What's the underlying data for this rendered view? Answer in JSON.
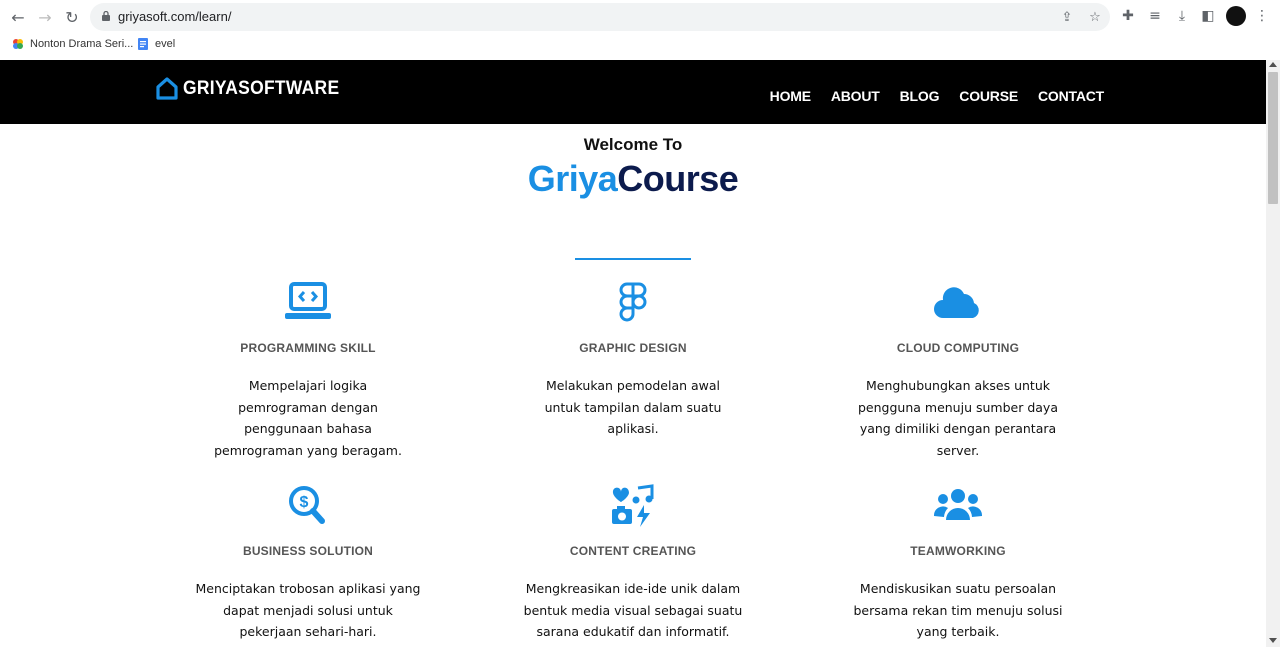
{
  "browser": {
    "url": "griyasoft.com/learn/",
    "bookmarks": [
      {
        "label": "Nonton Drama Seri..."
      },
      {
        "label": "evel"
      }
    ]
  },
  "site": {
    "logo_text": "GRIYASOFTWARE",
    "menu": [
      "HOME",
      "ABOUT",
      "BLOG",
      "COURSE",
      "CONTACT"
    ],
    "welcome": "Welcome To",
    "brand_part1": "Griya",
    "brand_part2": "Course",
    "accent_color": "#1a8fe3",
    "cards": [
      {
        "icon": "laptop-code-icon",
        "title": "PROGRAMMING SKILL",
        "desc": "Mempelajari logika pemrograman dengan penggunaan bahasa pemrograman yang beragam."
      },
      {
        "icon": "figma-icon",
        "title": "GRAPHIC DESIGN",
        "desc": "Melakukan pemodelan awal untuk tampilan dalam suatu aplikasi."
      },
      {
        "icon": "cloud-icon",
        "title": "CLOUD COMPUTING",
        "desc": "Menghubungkan akses untuk pengguna menuju sumber daya yang dimiliki dengan perantara server."
      },
      {
        "icon": "search-dollar-icon",
        "title": "BUSINESS SOLUTION",
        "desc": "Menciptakan trobosan aplikasi yang dapat menjadi solusi untuk pekerjaan sehari-hari."
      },
      {
        "icon": "photo-video-icon",
        "title": "CONTENT CREATING",
        "desc": "Mengkreasikan ide-ide unik dalam bentuk media visual sebagai suatu sarana edukatif dan informatif."
      },
      {
        "icon": "users-icon",
        "title": "TEAMWORKING",
        "desc": "Mendiskusikan suatu persoalan bersama rekan tim menuju solusi yang terbaik."
      }
    ]
  }
}
